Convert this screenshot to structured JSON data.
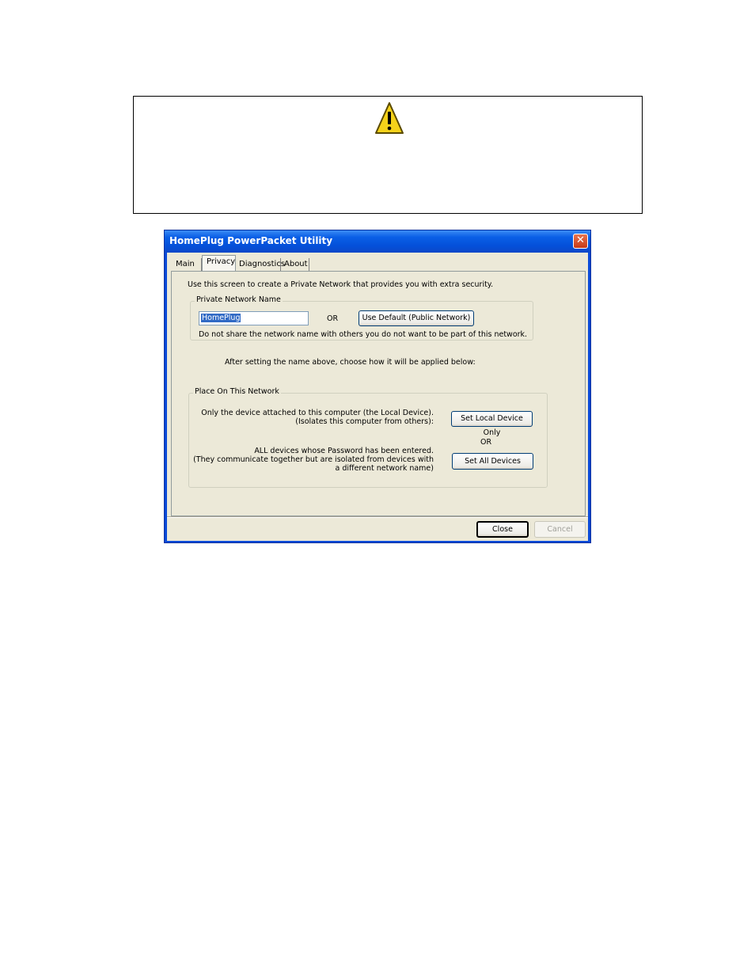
{
  "window": {
    "title": "HomePlug PowerPacket Utility",
    "close_glyph": "✕"
  },
  "tabs": [
    {
      "label": "Main"
    },
    {
      "label": "Privacy"
    },
    {
      "label": "Diagnostics"
    },
    {
      "label": "About"
    }
  ],
  "privacy": {
    "intro": "Use this screen to create a Private Network that provides you with extra security.",
    "network_group_label": "Private Network Name",
    "network_name_value": "HomePlug",
    "or_label": "OR",
    "use_default_label": "Use Default (Public Network)",
    "share_note": "Do not share the network name with others you do not want to be part of this network.",
    "after_setting_note": "After setting the name above, choose how it will be applied below:",
    "place_group_label": "Place On This Network",
    "local_desc_line1": "Only the device attached to this computer (the Local Device).",
    "local_desc_line2": "(Isolates this computer from others):",
    "set_local_label": "Set Local Device Only",
    "or_label_2": "OR",
    "all_desc_line1": "ALL devices whose Password has been entered.",
    "all_desc_line2": "(They communicate together but are isolated from devices with",
    "all_desc_line3": "a different network name)",
    "set_all_label": "Set All Devices"
  },
  "footer": {
    "close_label": "Close",
    "cancel_label": "Cancel"
  },
  "colors": {
    "warning_yellow": "#f5d21a",
    "titlebar_blue": "#0450d9",
    "dialog_face": "#ece9d8"
  }
}
